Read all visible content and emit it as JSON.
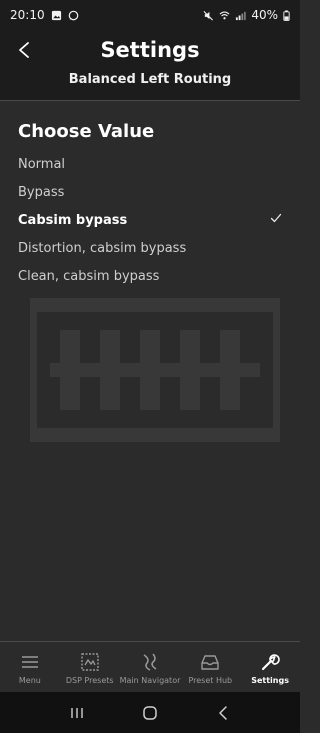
{
  "status_bar": {
    "time": "20:10",
    "battery": "40%"
  },
  "header": {
    "title": "Settings",
    "subtitle": "Balanced Left Routing"
  },
  "content": {
    "section_title": "Choose Value",
    "options": [
      {
        "label": "Normal",
        "selected": false
      },
      {
        "label": "Bypass",
        "selected": false
      },
      {
        "label": "Cabsim bypass",
        "selected": true
      },
      {
        "label": "Distortion, cabsim bypass",
        "selected": false
      },
      {
        "label": "Clean, cabsim bypass",
        "selected": false
      }
    ]
  },
  "bottom_nav": {
    "items": [
      {
        "label": "Menu",
        "icon": "menu-icon",
        "active": false
      },
      {
        "label": "DSP Presets",
        "icon": "dsp-presets-icon",
        "active": false
      },
      {
        "label": "Main Navigator",
        "icon": "main-navigator-icon",
        "active": false
      },
      {
        "label": "Preset Hub",
        "icon": "preset-hub-icon",
        "active": false
      },
      {
        "label": "Settings",
        "icon": "wrench-icon",
        "active": true
      }
    ]
  },
  "colors": {
    "background": "#2b2b2b",
    "header_background": "#1c1c1c",
    "text_primary": "#ffffff",
    "text_secondary": "#cfcfcf",
    "divider": "#4a4a4a"
  }
}
